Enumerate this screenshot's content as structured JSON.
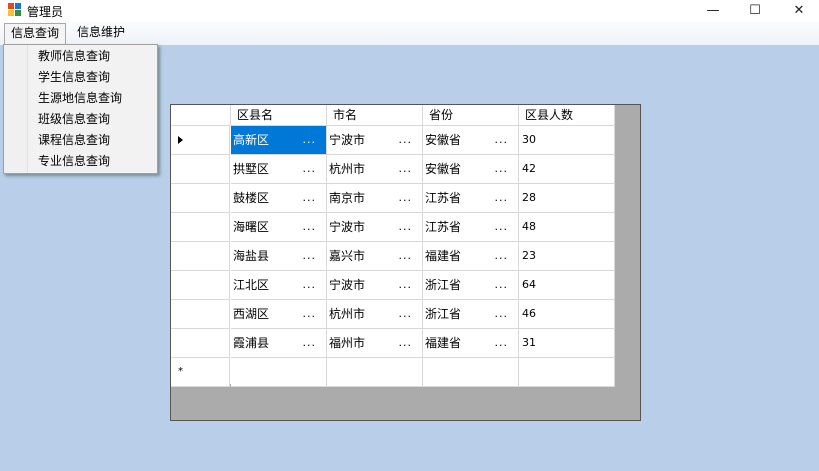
{
  "window": {
    "title": "管理员",
    "icon": "app-window-icon",
    "controls": {
      "minimize": "—",
      "maximize": "☐",
      "close": "✕"
    }
  },
  "menubar": {
    "items": [
      {
        "label": "信息查询",
        "open": true
      },
      {
        "label": "信息维护",
        "open": false
      }
    ]
  },
  "dropdown": {
    "items": [
      "教师信息查询",
      "学生信息查询",
      "生源地信息查询",
      "班级信息查询",
      "课程信息查询",
      "专业信息查询"
    ]
  },
  "grid": {
    "columns": [
      "区县名",
      "市名",
      "省份",
      "区县人数"
    ],
    "ellipsis": "...",
    "rows": [
      {
        "county": "高新区",
        "city": "宁波市",
        "province": "安徽省",
        "population": "30"
      },
      {
        "county": "拱墅区",
        "city": "杭州市",
        "province": "安徽省",
        "population": "42"
      },
      {
        "county": "鼓楼区",
        "city": "南京市",
        "province": "江苏省",
        "population": "28"
      },
      {
        "county": "海曙区",
        "city": "宁波市",
        "province": "江苏省",
        "population": "48"
      },
      {
        "county": "海盐县",
        "city": "嘉兴市",
        "province": "福建省",
        "population": "23"
      },
      {
        "county": "江北区",
        "city": "宁波市",
        "province": "浙江省",
        "population": "64"
      },
      {
        "county": "西湖区",
        "city": "杭州市",
        "province": "浙江省",
        "population": "46"
      },
      {
        "county": "霞浦县",
        "city": "福州市",
        "province": "福建省",
        "population": "31"
      }
    ],
    "new_row_marker": "*",
    "selected_cell": {
      "row": 0,
      "column": "county",
      "color": "#0078d7"
    }
  },
  "colors": {
    "desktop_bg": "#b9cfe9",
    "grid_bg": "#ababab",
    "selection": "#0078d7"
  }
}
